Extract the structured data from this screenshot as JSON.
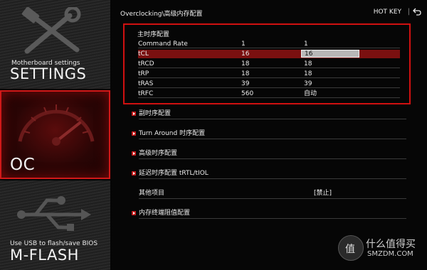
{
  "sidebar": {
    "settings": {
      "subtitle": "Motherboard settings",
      "title": "SETTINGS",
      "icon": "tools-icon"
    },
    "oc": {
      "title": "OC",
      "icon": "gauge-icon"
    },
    "mflash": {
      "subtitle": "Use USB to flash/save BIOS",
      "title": "M-FLASH",
      "icon": "usb-icon"
    }
  },
  "header": {
    "breadcrumb": "Overclocking\\高级内存配置",
    "hotkey": "HOT KEY",
    "separator": "|",
    "back_icon": "back-arrow-icon"
  },
  "timings": {
    "header": "主时序配置",
    "rows": [
      {
        "label": "Command Rate",
        "current": "1",
        "setting": "1"
      },
      {
        "label": "tCL",
        "current": "16",
        "setting": "16",
        "selected": true
      },
      {
        "label": "tRCD",
        "current": "18",
        "setting": "18"
      },
      {
        "label": "tRP",
        "current": "18",
        "setting": "18"
      },
      {
        "label": "tRAS",
        "current": "39",
        "setting": "39"
      },
      {
        "label": "tRFC",
        "current": "560",
        "setting": "自动"
      }
    ]
  },
  "menu": {
    "items": [
      {
        "label": "副时序配置",
        "expandable": true
      },
      {
        "label": "Turn Around 时序配置",
        "expandable": true
      },
      {
        "label": "高级时序配置",
        "expandable": true
      },
      {
        "label": "延迟时序配置 tRTL/tIOL",
        "expandable": true
      },
      {
        "label": "其他项目",
        "expandable": false,
        "value": "[禁止]"
      },
      {
        "label": "内存终端阻值配置",
        "expandable": true
      }
    ]
  },
  "watermark": {
    "badge_glyph": "值",
    "line1": "什么值得买",
    "line2": "SMZDM.COM"
  },
  "colors": {
    "accent": "#d01010",
    "selected_row": "#7a1010",
    "selected_field": "#b8b8b8"
  }
}
